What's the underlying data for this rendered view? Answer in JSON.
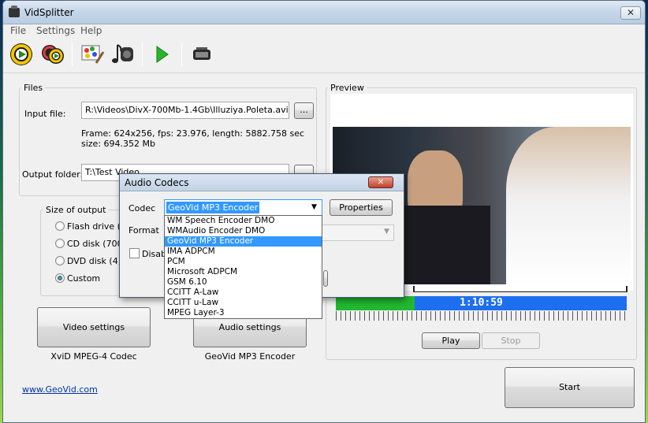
{
  "window": {
    "title": "VidSplitter",
    "close_symbol": "✕"
  },
  "menu": [
    "File",
    "Settings",
    "Help"
  ],
  "toolbar": {
    "icons": [
      "play-circle-icon",
      "multi-play-icon",
      "palette-icon",
      "music-icon",
      "play-arrow-icon",
      "film-icon"
    ]
  },
  "files": {
    "legend": "Files",
    "input_label": "Input file:",
    "input_value": "R:\\Videos\\DivX-700Mb-1.4Gb\\Illuziya.Poleta.avi",
    "browse_label": "...",
    "info_line1": "Frame: 624x256, fps: 23.976, length: 5882.758 sec",
    "info_line2": "size: 694.352 Mb",
    "output_label": "Output folder:",
    "output_value": "T:\\Test Video"
  },
  "size_output": {
    "legend": "Size of output",
    "options": [
      "Flash drive (",
      "CD disk (700M",
      "DVD disk (4,7",
      "Custom"
    ],
    "selected": "Custom"
  },
  "video_settings": {
    "label": "Video settings",
    "codec": "XviD MPEG-4 Codec"
  },
  "audio_settings": {
    "label": "Audio settings",
    "codec": "GeoVid MP3 Encoder"
  },
  "preview": {
    "legend": "Preview",
    "time": "1:10:59",
    "play_label": "Play",
    "stop_label": "Stop",
    "progress": 0.27
  },
  "start_label": "Start",
  "footer_link": "www.GeoVid.com",
  "dialog": {
    "title": "Audio Codecs",
    "close_symbol": "✕",
    "codec_label": "Codec",
    "codec_value": "GeoVid MP3 Encoder",
    "properties_label": "Properties",
    "format_label": "Format",
    "disable_label": "Disab",
    "codec_options": [
      "WM Speech Encoder DMO",
      "WMAudio Encoder DMO",
      "GeoVid MP3 Encoder",
      "IMA ADPCM",
      "PCM",
      "Microsoft ADPCM",
      "GSM 6.10",
      "CCITT A-Law",
      "CCITT u-Law",
      "MPEG Layer-3"
    ]
  },
  "colors": {
    "track": "#1e6ef0",
    "track_played": "#20b830",
    "selection": "#3399ff",
    "link": "#0033aa"
  }
}
